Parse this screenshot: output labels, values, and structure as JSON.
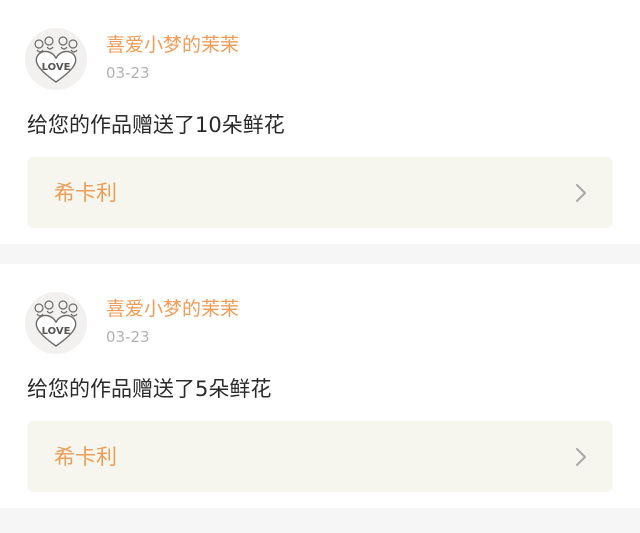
{
  "feed": {
    "items": [
      {
        "user": "喜爱小梦的茉茉",
        "date": "03-23",
        "message": "给您的作品赠送了10朵鲜花",
        "work_title": "希卡利",
        "avatar_text": "LOVE"
      },
      {
        "user": "喜爱小梦的茉茉",
        "date": "03-23",
        "message": "给您的作品赠送了5朵鲜花",
        "work_title": "希卡利",
        "avatar_text": "LOVE"
      }
    ]
  },
  "icons": {
    "avatar": "love-heart-avatar-icon",
    "chevron": "chevron-right-icon"
  },
  "colors": {
    "accent": "#ee9c57",
    "date_gray": "#b2b2b2",
    "card_bg": "#ffffff",
    "link_bg": "#f6f6ee",
    "page_bg": "#f6f6f6"
  }
}
